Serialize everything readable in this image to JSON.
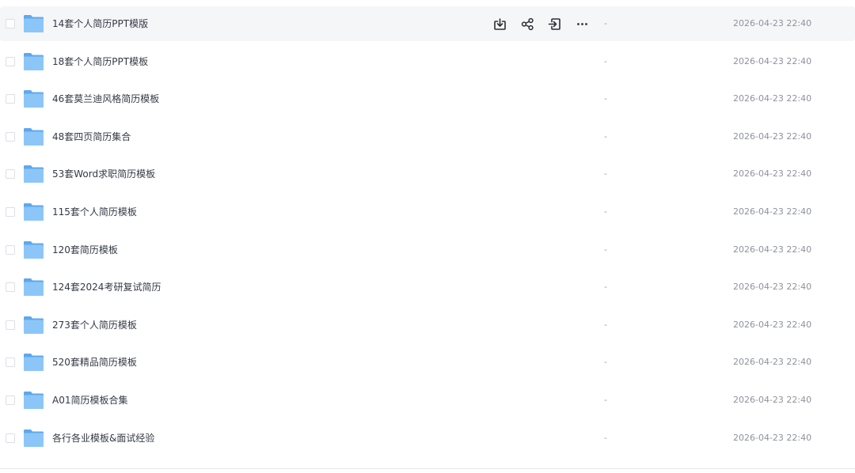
{
  "files": [
    {
      "name": "14套个人简历PPT模版",
      "size": "-",
      "modified": "2026-04-23 22:40"
    },
    {
      "name": "18套个人简历PPT模板",
      "size": "-",
      "modified": "2026-04-23 22:40"
    },
    {
      "name": "46套莫兰迪风格简历模板",
      "size": "-",
      "modified": "2026-04-23 22:40"
    },
    {
      "name": "48套四页简历集合",
      "size": "-",
      "modified": "2026-04-23 22:40"
    },
    {
      "name": "53套Word求职简历模板",
      "size": "-",
      "modified": "2026-04-23 22:40"
    },
    {
      "name": "115套个人简历模板",
      "size": "-",
      "modified": "2026-04-23 22:40"
    },
    {
      "name": "120套简历模板",
      "size": "-",
      "modified": "2026-04-23 22:40"
    },
    {
      "name": "124套2024考研复试简历",
      "size": "-",
      "modified": "2026-04-23 22:40"
    },
    {
      "name": "273套个人简历模板",
      "size": "-",
      "modified": "2026-04-23 22:40"
    },
    {
      "name": "520套精品简历模板",
      "size": "-",
      "modified": "2026-04-23 22:40"
    },
    {
      "name": "A01简历模板合集",
      "size": "-",
      "modified": "2026-04-23 22:40"
    },
    {
      "name": "各行各业模板&面试经验",
      "size": "-",
      "modified": "2026-04-23 22:40"
    }
  ],
  "hovered_row": 0,
  "row_actions": [
    "download-icon",
    "share-icon",
    "move-icon",
    "more-icon"
  ],
  "colors": {
    "folder": "#6db3f2",
    "folder_light": "#9fd0fb",
    "text": "#333a45",
    "muted": "#8d939c",
    "hover_bg": "#f5f6f8",
    "icon": "#2b2f36"
  }
}
